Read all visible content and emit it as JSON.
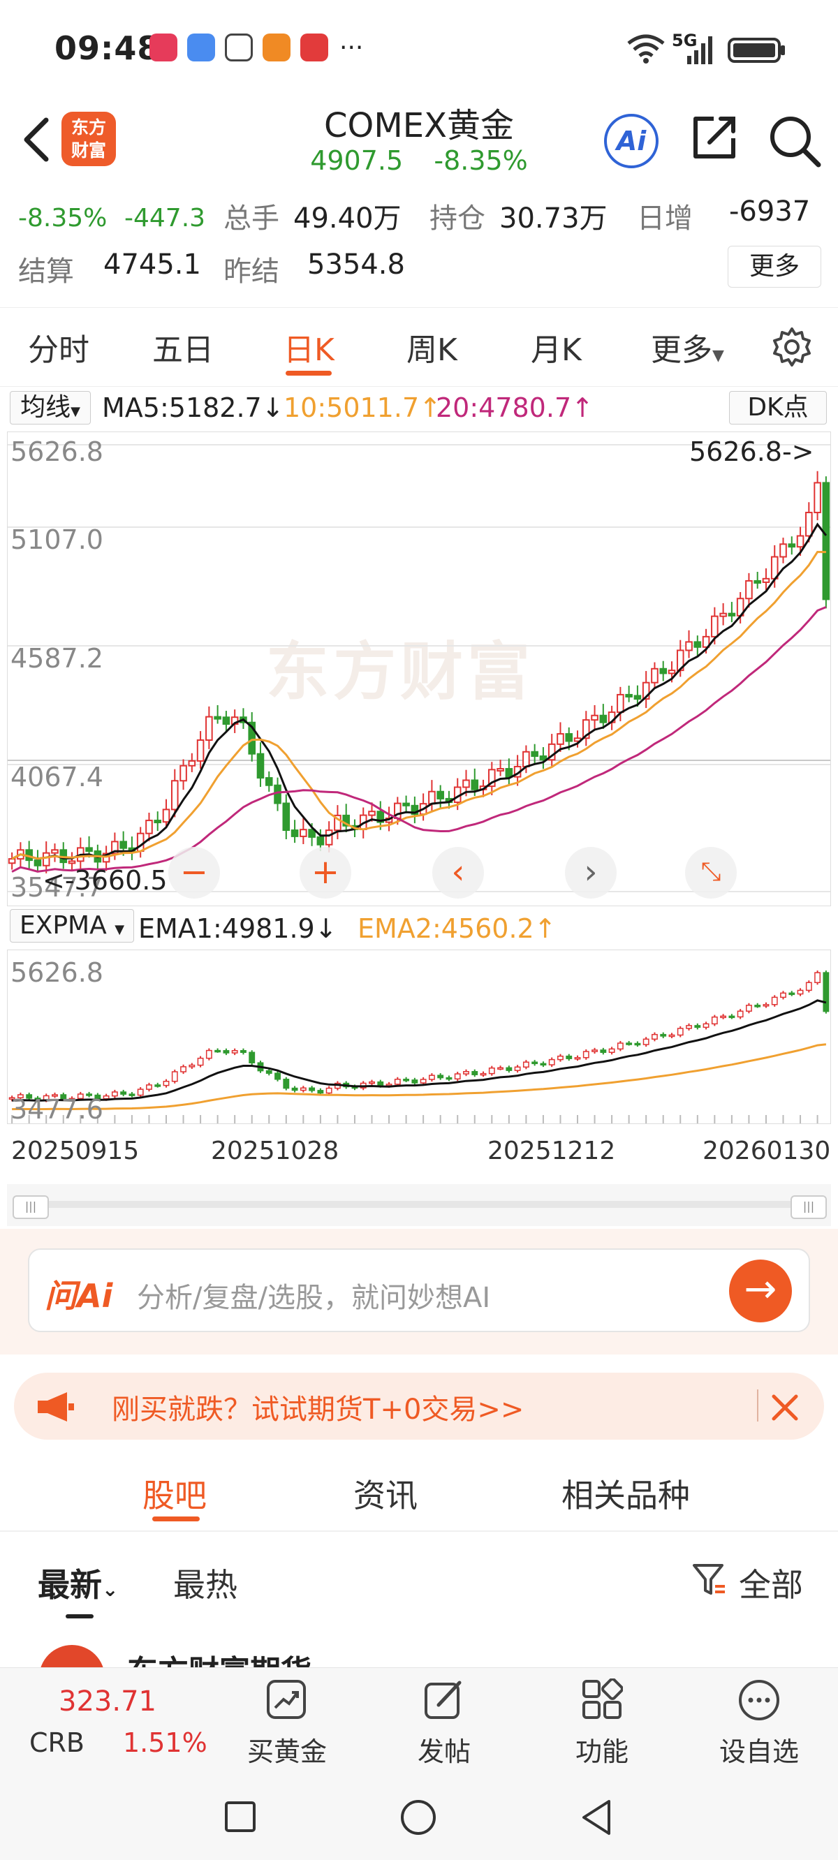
{
  "status": {
    "time": "09:48",
    "network": "5G",
    "more": "···"
  },
  "header": {
    "logo_line1": "东方",
    "logo_line2": "财富",
    "title": "COMEX黄金",
    "price": "4907.5",
    "change_pct": "-8.35%",
    "ai_label": "Ai"
  },
  "stats": {
    "change_pct": "-8.35%",
    "change_amt": "-447.3",
    "volume_label": "总手",
    "volume": "49.40万",
    "open_interest_label": "持仓",
    "open_interest": "30.73万",
    "daily_increase_label": "日增",
    "daily_increase": "-6937",
    "settle_label": "结算",
    "settle": "4745.1",
    "prev_settle_label": "昨结",
    "prev_settle": "5354.8",
    "more_button": "更多"
  },
  "period_tabs": [
    "分时",
    "五日",
    "日K",
    "周K",
    "月K",
    "更多"
  ],
  "active_period": "日K",
  "ma_legend": {
    "selector": "均线",
    "ma5": "MA5:5182.7↓",
    "ma10": "10:5011.7↑",
    "ma20": "20:4780.7↑",
    "dk_button": "DK点"
  },
  "main_chart": {
    "y_labels": [
      "5626.8",
      "5107.0",
      "4587.2",
      "4067.4",
      "3547.7"
    ],
    "high_marker": "5626.8->",
    "low_marker": "<-3660.5",
    "watermark": "东方财富"
  },
  "sub_legend": {
    "selector": "EXPMA",
    "ema1": "EMA1:4981.9↓",
    "ema2": "EMA2:4560.2↑"
  },
  "sub_chart": {
    "y_labels": [
      "5626.8",
      "3477.6"
    ]
  },
  "date_labels": [
    "20250915",
    "20251028",
    "20251212",
    "20260130"
  ],
  "chart_data": {
    "type": "candlestick",
    "x_range": [
      "20250915",
      "20260130"
    ],
    "ylim": [
      3547.7,
      5626.8
    ],
    "high": 5626.8,
    "low": 3660.5,
    "series": [
      {
        "name": "MA5",
        "last": 5182.7
      },
      {
        "name": "MA10",
        "last": 5011.7
      },
      {
        "name": "MA20",
        "last": 4780.7
      },
      {
        "name": "EMA1",
        "last": 4981.9
      },
      {
        "name": "EMA2",
        "last": 4560.2
      }
    ],
    "colors": {
      "up": "#e03333",
      "down": "#2f9a2f",
      "ma5": "#111111",
      "ma10": "#f0a030",
      "ma20": "#c0287a"
    }
  },
  "ai_input": {
    "logo": "问Ai",
    "placeholder": "分析/复盘/选股，就问妙想AI"
  },
  "promo": {
    "text": "刚买就跌？试试期货T+0交易>>"
  },
  "community_tabs": [
    "股吧",
    "资讯",
    "相关品种"
  ],
  "sort_tabs": {
    "latest": "最新",
    "hot": "最热",
    "filter": "全部"
  },
  "post_author_partial": "东方财富期货",
  "bottom_nav": {
    "index_value": "323.71",
    "index_name": "CRB",
    "index_change": "1.51%",
    "items": [
      "买黄金",
      "发帖",
      "功能",
      "设自选"
    ]
  }
}
